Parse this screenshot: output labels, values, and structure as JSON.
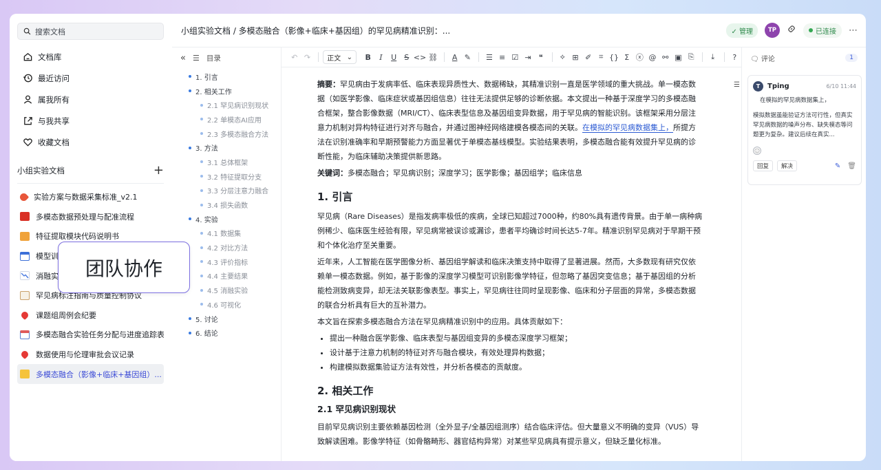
{
  "sidebar": {
    "search_placeholder": "搜索文档",
    "nav": [
      {
        "label": "文档库",
        "icon": "home-icon"
      },
      {
        "label": "最近访问",
        "icon": "history-icon"
      },
      {
        "label": "属我所有",
        "icon": "user-icon"
      },
      {
        "label": "与我共享",
        "icon": "share-icon"
      },
      {
        "label": "收藏文档",
        "icon": "heart-icon"
      }
    ],
    "group_title": "小组实验文档",
    "docs": [
      {
        "label": "实验方案与数据采集标准_v2.1",
        "icon": "rocket-icon",
        "color": "#e8563a"
      },
      {
        "label": "多模态数据预处理与配准流程",
        "icon": "red-book-icon",
        "color": "#d93025"
      },
      {
        "label": "特征提取模块代码说明书",
        "icon": "orange-book-icon",
        "color": "#f0a23a"
      },
      {
        "label": "模型训练日志",
        "icon": "calendar-icon",
        "color": "#3b6fd8"
      },
      {
        "label": "消融实验结果",
        "icon": "chart-down-icon",
        "color": "#4a7be0"
      },
      {
        "label": "罕见病标注指南与质量控制协议",
        "icon": "clipboard-icon",
        "color": "#c9a16a"
      },
      {
        "label": "课题组周例会纪要",
        "icon": "pin-icon",
        "color": "#e53935"
      },
      {
        "label": "多模态融合实验任务分配与进度追踪表",
        "icon": "spiral-calendar-icon",
        "color": "#5a7fd0"
      },
      {
        "label": "数据使用与伦理审批会议记录",
        "icon": "pin-icon",
        "color": "#e53935"
      },
      {
        "label": "多模态融合（影像+临床+基因组）...",
        "icon": "yellow-book-icon",
        "color": "#f5c33b"
      }
    ],
    "popup": "团队协作"
  },
  "topbar": {
    "title": "小组实验文档 / 多模态融合（影像+临床+基因组）的罕见病精准识别：...",
    "manage": "✓ 管理",
    "avatar": "TP",
    "connected": "已连接"
  },
  "outline": {
    "title": "目录",
    "items": [
      {
        "label": "1. 引言",
        "level": 1
      },
      {
        "label": "2. 相关工作",
        "level": 1
      },
      {
        "label": "2.1 罕见病识别现状",
        "level": 2
      },
      {
        "label": "2.2 单模态AI应用",
        "level": 2
      },
      {
        "label": "2.3 多模态融合方法",
        "level": 2
      },
      {
        "label": "3. 方法",
        "level": 1
      },
      {
        "label": "3.1 总体框架",
        "level": 2
      },
      {
        "label": "3.2 特征提取分支",
        "level": 2
      },
      {
        "label": "3.3 分层注意力融合",
        "level": 2
      },
      {
        "label": "3.4 损失函数",
        "level": 2
      },
      {
        "label": "4. 实验",
        "level": 1
      },
      {
        "label": "4.1 数据集",
        "level": 2
      },
      {
        "label": "4.2 对比方法",
        "level": 2
      },
      {
        "label": "4.3 评价指标",
        "level": 2
      },
      {
        "label": "4.4 主要结果",
        "level": 2
      },
      {
        "label": "4.5 消融实验",
        "level": 2
      },
      {
        "label": "4.6 可视化",
        "level": 2
      },
      {
        "label": "5. 讨论",
        "level": 1
      },
      {
        "label": "6. 结论",
        "level": 1
      }
    ]
  },
  "toolbar": {
    "style_select": "正文"
  },
  "document": {
    "abstract_label": "摘要：",
    "abstract_a": "罕见病由于发病率低、临床表现异质性大、数据稀缺，其精准识别一直是医学领域的重大挑战。单一模态数据（如医学影像、临床症状或基因组信息）往往无法提供足够的诊断依据。本文提出一种基于深度学习的多模态融合框架，整合影像数据（MRI/CT）、临床表型信息及基因组变异数据，用于罕见病的智能识别。该框架采用分层注意力机制对异构特征进行对齐与融合，并通过图神经网络建模各模态间的关联。",
    "abstract_highlight": "在模拟的罕见病数据集上，",
    "abstract_b": "所提方法在识别准确率和早期预警能力方面显著优于单模态基线模型。实验结果表明，多模态融合能有效提升罕见病的诊断性能，为临床辅助决策提供新思路。",
    "keywords_label": "关键词：",
    "keywords": "多模态融合；罕见病识别；深度学习；医学影像；基因组学；临床信息",
    "h1_intro": "1. 引言",
    "intro_p1": "罕见病（Rare Diseases）是指发病率极低的疾病，全球已知超过7000种，约80%具有遗传背景。由于单一病种病例稀少、临床医生经验有限，罕见病常被误诊或漏诊，患者平均确诊时间长达5-7年。精准识别罕见病对于早期干预和个体化治疗至关重要。",
    "intro_p2": "近年来，人工智能在医学图像分析、基因组学解读和临床决策支持中取得了显著进展。然而，大多数现有研究仅依赖单一模态数据。例如，基于影像的深度学习模型可识别影像学特征，但忽略了基因突变信息；基于基因组的分析能检测致病变异，却无法关联影像表型。事实上，罕见病往往同时呈现影像、临床和分子层面的异常，多模态数据的联合分析具有巨大的互补潜力。",
    "intro_p3": "本文旨在探索多模态融合方法在罕见病精准识别中的应用。具体贡献如下：",
    "contributions": [
      "提出一种融合医学影像、临床表型与基因组变异的多模态深度学习框架；",
      "设计基于注意力机制的特征对齐与融合模块，有效处理异构数据；",
      "构建模拟数据集验证方法有效性，并分析各模态的贡献度。"
    ],
    "h1_related": "2. 相关工作",
    "h2_status": "2.1 罕见病识别现状",
    "status_p1": "目前罕见病识别主要依赖基因检测（全外显子/全基因组测序）结合临床评估。但大量意义不明确的变异（VUS）导致解读困难。影像学特征（如骨骼畸形、器官结构异常）对某些罕见病具有提示意义，但缺乏量化标准。"
  },
  "comments": {
    "title": "评论",
    "count": "1",
    "card": {
      "avatar": "T",
      "user": "Tping",
      "time": "6/10 11:44",
      "quote": "在模拟的罕见病数据集上，",
      "text": "模拟数据虽能验证方法可行性，但真实罕见病数据的噪声分布、缺失模态等问题更为复杂。建议后续在真实...",
      "reply": "回复",
      "resolve": "解决"
    }
  }
}
